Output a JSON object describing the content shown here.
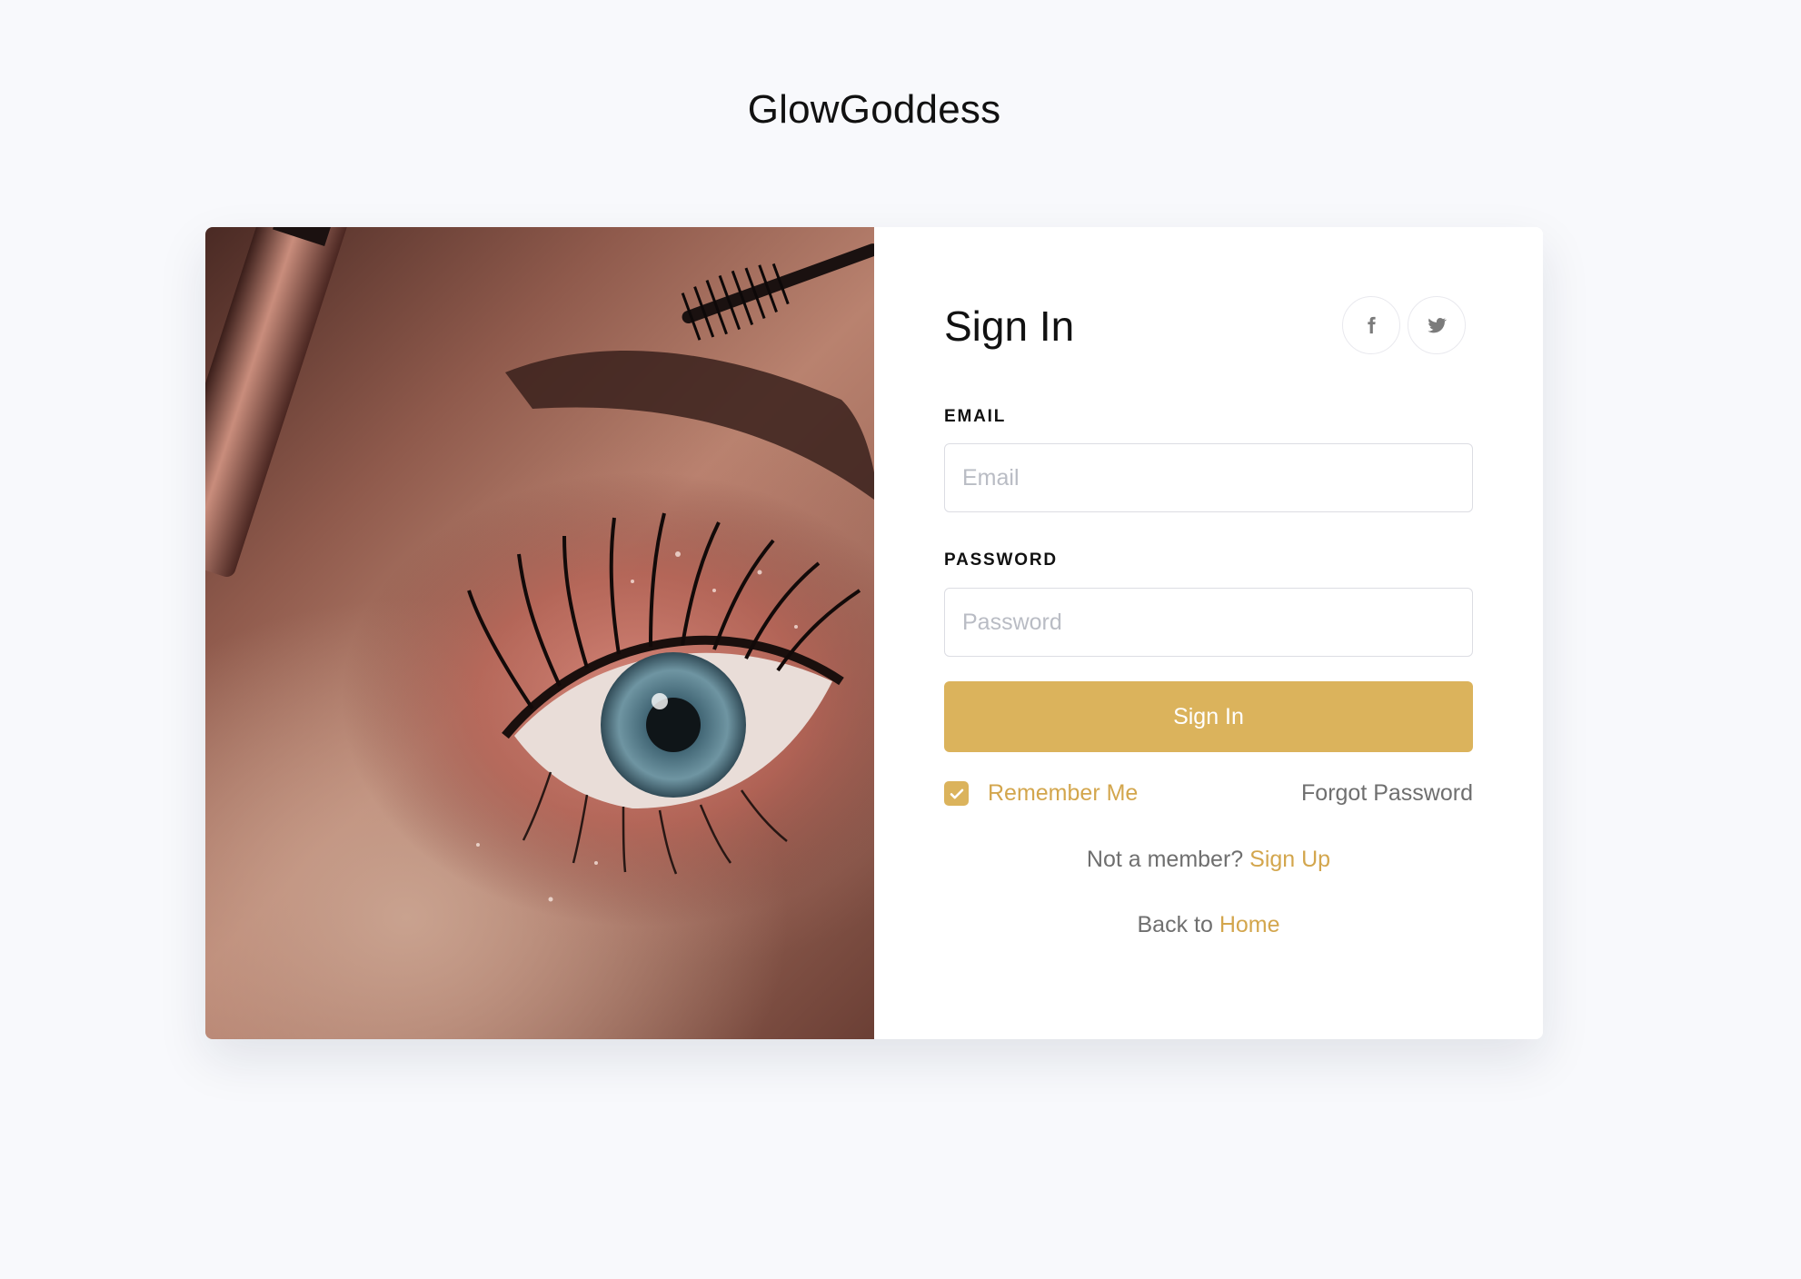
{
  "brand": {
    "name": "GlowGoddess"
  },
  "image": {
    "alt_icon": "eye-makeup-photo"
  },
  "signin": {
    "title": "Sign In",
    "social": [
      {
        "name": "facebook",
        "icon": "facebook-icon"
      },
      {
        "name": "twitter",
        "icon": "twitter-icon"
      }
    ],
    "email": {
      "label": "EMAIL",
      "placeholder": "Email",
      "value": ""
    },
    "password": {
      "label": "PASSWORD",
      "placeholder": "Password",
      "value": ""
    },
    "submit_label": "Sign In",
    "remember_label": "Remember Me",
    "remember_checked": true,
    "forgot_label": "Forgot Password",
    "signup_prompt": "Not a member? ",
    "signup_link": "Sign Up",
    "home_prompt": "Back to ",
    "home_link": "Home"
  },
  "colors": {
    "accent": "#dbb35c",
    "accent_text": "#d3a64d",
    "background": "#f8f9fc",
    "muted_text": "#6f6f6f"
  }
}
